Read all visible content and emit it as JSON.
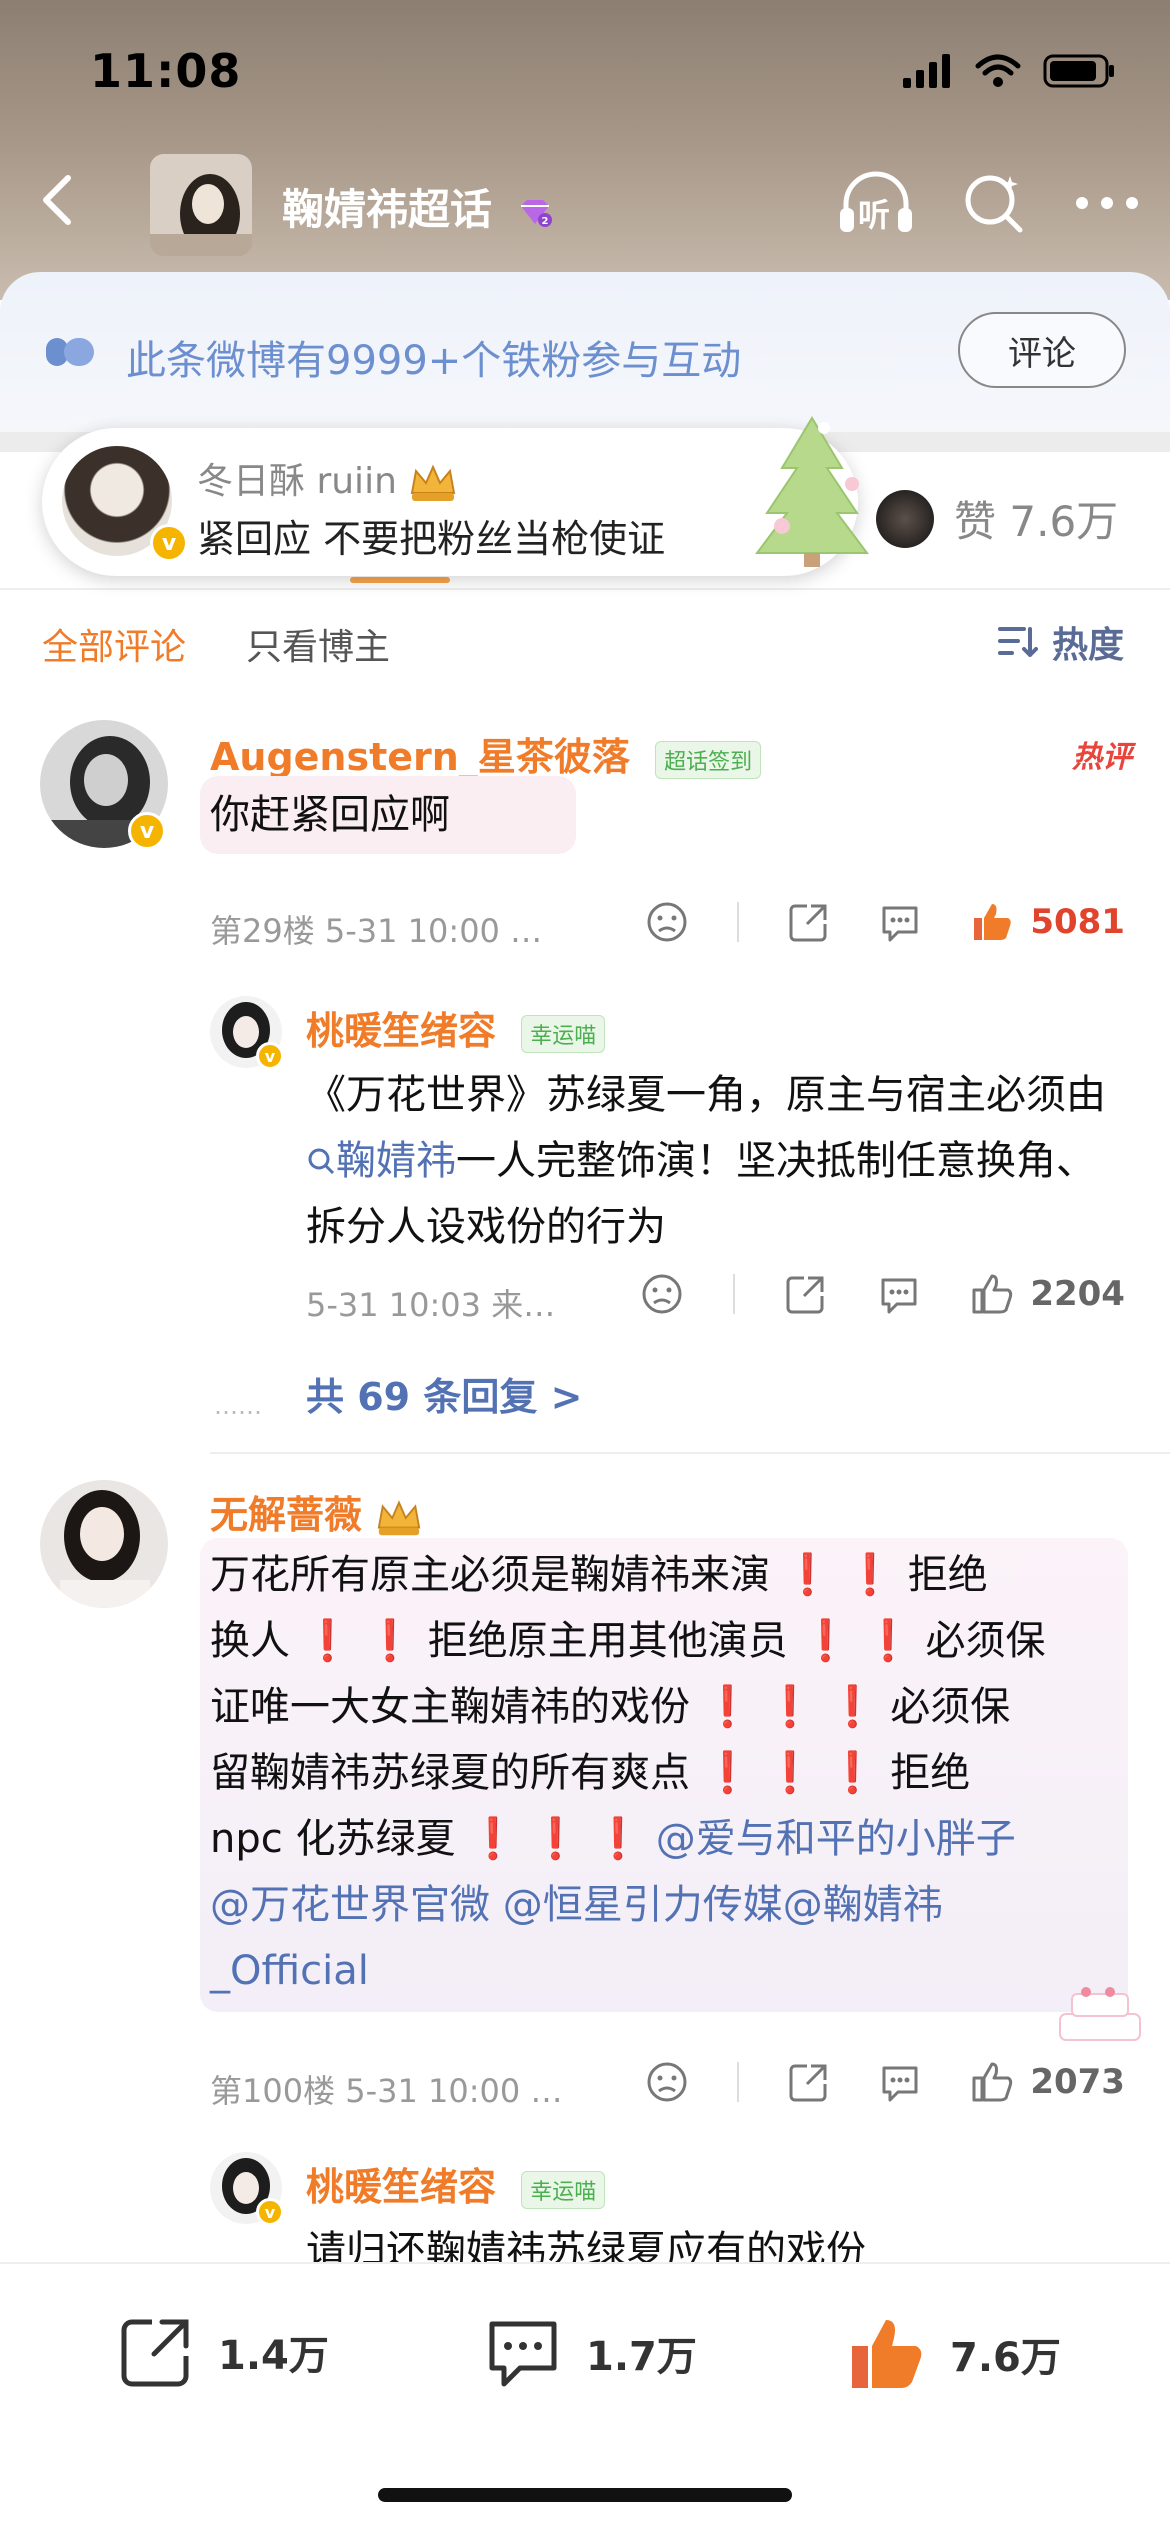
{
  "status_bar": {
    "time": "11:08"
  },
  "nav": {
    "title": "鞠婧祎超话",
    "listen_label": "听"
  },
  "banner": {
    "text": "此条微博有9999+个铁粉参与互动",
    "button": "评论"
  },
  "floating_card": {
    "name": "冬日酥 ruiin",
    "text": "紧回应 不要把粉丝当枪使证"
  },
  "likes_summary": {
    "label": "赞",
    "count": "7.6万"
  },
  "filter": {
    "all": "全部评论",
    "owner_only": "只看博主",
    "sort": "热度"
  },
  "comments": [
    {
      "name": "Augenstern_星茶彼落",
      "tag": "超话签到",
      "hot": "热评",
      "text": "你赶紧回应啊",
      "meta": "第29楼 5-31 10:00 …",
      "likes": "5081",
      "reply": {
        "name": "桃暖笙绪容",
        "tag": "幸运喵",
        "text_pre": "《万花世界》苏绿夏一角，原主与宿主必须由",
        "text_link": "鞠婧祎",
        "text_post": "一人完整饰演！坚决抵制任意换角、拆分人设戏份的行为",
        "meta": "5-31 10:03 来…",
        "likes": "2204"
      },
      "more_replies": "共 69 条回复 >"
    },
    {
      "name": "无解蔷薇",
      "text_line1": "万花所有原主必须是鞠婧祎来演",
      "text_line1b": "拒绝",
      "text_line2a": "换人",
      "text_line2b": "拒绝原主用其他演员",
      "text_line2c": "必须保",
      "text_line3a": "证唯一大女主鞠婧祎的戏份",
      "text_line3b": "必须保",
      "text_line4a": "留鞠婧祎苏绿夏的所有爽点",
      "text_line4b": "拒绝",
      "text_line5a": "npc 化苏绿夏",
      "mention1": "@爱与和平的小胖子",
      "mention2": "@万花世界官微",
      "mention3": "@恒星引力传媒",
      "mention4": "@鞠婧祎",
      "mention4b": "_Official",
      "meta": "第100楼 5-31 10:00 …",
      "likes": "2073",
      "reply": {
        "name": "桃暖笙绪容",
        "tag": "幸运喵",
        "text": "请归还鞠婧祎苏绿夏应有的戏份"
      }
    }
  ],
  "bottom_bar": {
    "shares": "1.4万",
    "comments": "1.7万",
    "likes": "7.6万"
  },
  "colors": {
    "accent": "#f07c2a",
    "link": "#5372b4",
    "banner_text": "#6c8fd0"
  }
}
